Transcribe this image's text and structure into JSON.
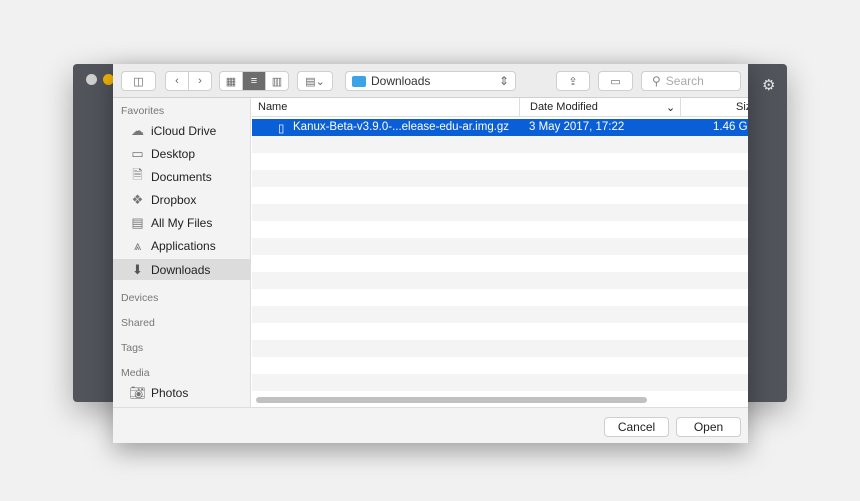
{
  "toolbar": {
    "location": "Downloads",
    "search_placeholder": "Search"
  },
  "sidebar": {
    "favorites_header": "Favorites",
    "favorites": [
      {
        "label": "iCloud Drive",
        "icon": "cloud-icon"
      },
      {
        "label": "Desktop",
        "icon": "desktop-icon"
      },
      {
        "label": "Documents",
        "icon": "documents-icon"
      },
      {
        "label": "Dropbox",
        "icon": "dropbox-icon"
      },
      {
        "label": "All My Files",
        "icon": "all-files-icon"
      },
      {
        "label": "Applications",
        "icon": "applications-icon"
      },
      {
        "label": "Downloads",
        "icon": "downloads-icon",
        "selected": true
      }
    ],
    "devices_header": "Devices",
    "shared_header": "Shared",
    "tags_header": "Tags",
    "media_header": "Media",
    "media": [
      {
        "label": "Photos",
        "icon": "camera-icon"
      }
    ]
  },
  "columns": {
    "name": "Name",
    "date": "Date Modified",
    "size": "Siz"
  },
  "files": [
    {
      "name": "Kanux-Beta-v3.9.0-...elease-edu-ar.img.gz",
      "date": "3 May 2017, 17:22",
      "size": "1.46 G",
      "selected": true
    }
  ],
  "footer": {
    "cancel": "Cancel",
    "open": "Open"
  },
  "colors": {
    "selection": "#0a5fd6",
    "backdrop_window": "#51545b"
  }
}
